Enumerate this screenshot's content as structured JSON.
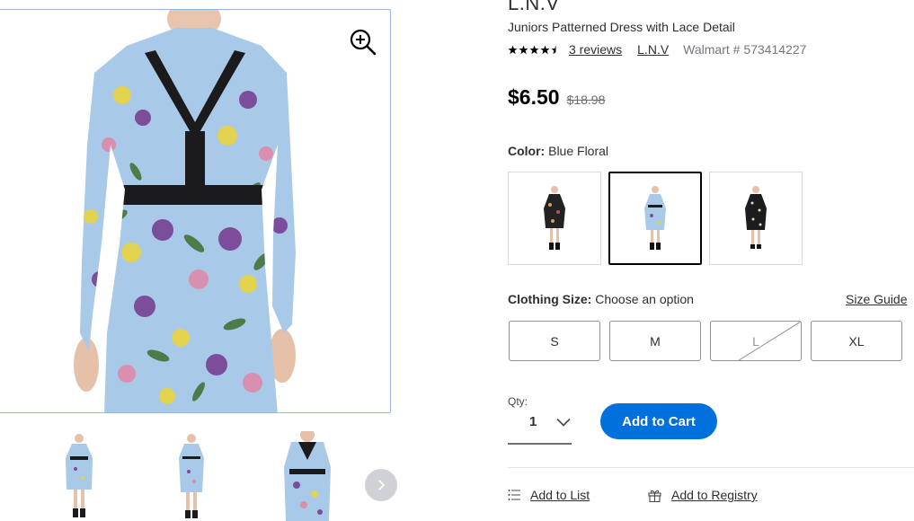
{
  "gallery": {
    "zoom_icon": "zoom-in-icon",
    "next_icon": "chevron-right-icon",
    "thumbnail_count": 4
  },
  "product": {
    "brand_heading": "L.N.V",
    "title": "Juniors Patterned Dress with Lace Detail",
    "rating_stars": 4.5,
    "reviews_link": "3 reviews",
    "brand_link": "L.N.V",
    "item_number": "Walmart # 573414227",
    "price": "$6.50",
    "was_price": "$18.98"
  },
  "color_option": {
    "label": "Color:",
    "selected_value": "Blue Floral",
    "swatches": [
      "black-floral",
      "blue-floral",
      "black-floral-alt"
    ],
    "selected_index": 1
  },
  "size_option": {
    "label": "Clothing Size:",
    "value": "Choose an option",
    "guide_link": "Size Guide",
    "sizes": [
      "S",
      "M",
      "L",
      "XL"
    ],
    "unavailable": [
      "L"
    ]
  },
  "quantity": {
    "label": "Qty:",
    "value": "1"
  },
  "cart": {
    "add_label": "Add to Cart"
  },
  "actions": {
    "add_to_list": "Add to List",
    "add_to_registry": "Add to Registry"
  },
  "colors": {
    "primary_blue": "#0071dc",
    "dress_blue": "#9dc3e6",
    "text": "#2e2f32"
  }
}
